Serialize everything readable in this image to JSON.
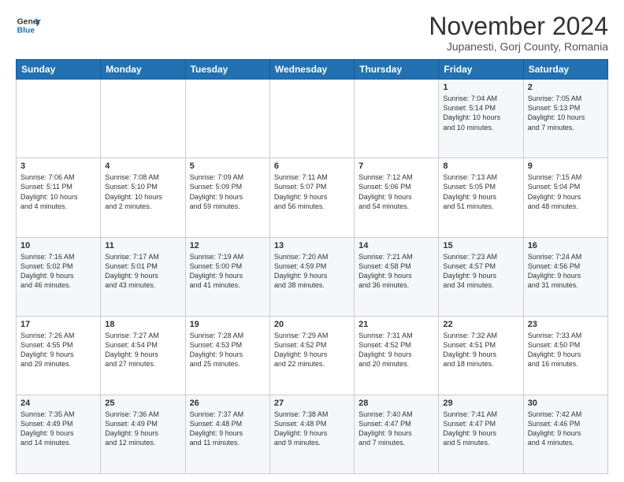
{
  "header": {
    "logo_line1": "General",
    "logo_line2": "Blue",
    "month": "November 2024",
    "location": "Jupanesti, Gorj County, Romania"
  },
  "days_of_week": [
    "Sunday",
    "Monday",
    "Tuesday",
    "Wednesday",
    "Thursday",
    "Friday",
    "Saturday"
  ],
  "weeks": [
    [
      {
        "day": "",
        "info": ""
      },
      {
        "day": "",
        "info": ""
      },
      {
        "day": "",
        "info": ""
      },
      {
        "day": "",
        "info": ""
      },
      {
        "day": "",
        "info": ""
      },
      {
        "day": "1",
        "info": "Sunrise: 7:04 AM\nSunset: 5:14 PM\nDaylight: 10 hours\nand 10 minutes."
      },
      {
        "day": "2",
        "info": "Sunrise: 7:05 AM\nSunset: 5:13 PM\nDaylight: 10 hours\nand 7 minutes."
      }
    ],
    [
      {
        "day": "3",
        "info": "Sunrise: 7:06 AM\nSunset: 5:11 PM\nDaylight: 10 hours\nand 4 minutes."
      },
      {
        "day": "4",
        "info": "Sunrise: 7:08 AM\nSunset: 5:10 PM\nDaylight: 10 hours\nand 2 minutes."
      },
      {
        "day": "5",
        "info": "Sunrise: 7:09 AM\nSunset: 5:09 PM\nDaylight: 9 hours\nand 59 minutes."
      },
      {
        "day": "6",
        "info": "Sunrise: 7:11 AM\nSunset: 5:07 PM\nDaylight: 9 hours\nand 56 minutes."
      },
      {
        "day": "7",
        "info": "Sunrise: 7:12 AM\nSunset: 5:06 PM\nDaylight: 9 hours\nand 54 minutes."
      },
      {
        "day": "8",
        "info": "Sunrise: 7:13 AM\nSunset: 5:05 PM\nDaylight: 9 hours\nand 51 minutes."
      },
      {
        "day": "9",
        "info": "Sunrise: 7:15 AM\nSunset: 5:04 PM\nDaylight: 9 hours\nand 48 minutes."
      }
    ],
    [
      {
        "day": "10",
        "info": "Sunrise: 7:16 AM\nSunset: 5:02 PM\nDaylight: 9 hours\nand 46 minutes."
      },
      {
        "day": "11",
        "info": "Sunrise: 7:17 AM\nSunset: 5:01 PM\nDaylight: 9 hours\nand 43 minutes."
      },
      {
        "day": "12",
        "info": "Sunrise: 7:19 AM\nSunset: 5:00 PM\nDaylight: 9 hours\nand 41 minutes."
      },
      {
        "day": "13",
        "info": "Sunrise: 7:20 AM\nSunset: 4:59 PM\nDaylight: 9 hours\nand 38 minutes."
      },
      {
        "day": "14",
        "info": "Sunrise: 7:21 AM\nSunset: 4:58 PM\nDaylight: 9 hours\nand 36 minutes."
      },
      {
        "day": "15",
        "info": "Sunrise: 7:23 AM\nSunset: 4:57 PM\nDaylight: 9 hours\nand 34 minutes."
      },
      {
        "day": "16",
        "info": "Sunrise: 7:24 AM\nSunset: 4:56 PM\nDaylight: 9 hours\nand 31 minutes."
      }
    ],
    [
      {
        "day": "17",
        "info": "Sunrise: 7:26 AM\nSunset: 4:55 PM\nDaylight: 9 hours\nand 29 minutes."
      },
      {
        "day": "18",
        "info": "Sunrise: 7:27 AM\nSunset: 4:54 PM\nDaylight: 9 hours\nand 27 minutes."
      },
      {
        "day": "19",
        "info": "Sunrise: 7:28 AM\nSunset: 4:53 PM\nDaylight: 9 hours\nand 25 minutes."
      },
      {
        "day": "20",
        "info": "Sunrise: 7:29 AM\nSunset: 4:52 PM\nDaylight: 9 hours\nand 22 minutes."
      },
      {
        "day": "21",
        "info": "Sunrise: 7:31 AM\nSunset: 4:52 PM\nDaylight: 9 hours\nand 20 minutes."
      },
      {
        "day": "22",
        "info": "Sunrise: 7:32 AM\nSunset: 4:51 PM\nDaylight: 9 hours\nand 18 minutes."
      },
      {
        "day": "23",
        "info": "Sunrise: 7:33 AM\nSunset: 4:50 PM\nDaylight: 9 hours\nand 16 minutes."
      }
    ],
    [
      {
        "day": "24",
        "info": "Sunrise: 7:35 AM\nSunset: 4:49 PM\nDaylight: 9 hours\nand 14 minutes."
      },
      {
        "day": "25",
        "info": "Sunrise: 7:36 AM\nSunset: 4:49 PM\nDaylight: 9 hours\nand 12 minutes."
      },
      {
        "day": "26",
        "info": "Sunrise: 7:37 AM\nSunset: 4:48 PM\nDaylight: 9 hours\nand 11 minutes."
      },
      {
        "day": "27",
        "info": "Sunrise: 7:38 AM\nSunset: 4:48 PM\nDaylight: 9 hours\nand 9 minutes."
      },
      {
        "day": "28",
        "info": "Sunrise: 7:40 AM\nSunset: 4:47 PM\nDaylight: 9 hours\nand 7 minutes."
      },
      {
        "day": "29",
        "info": "Sunrise: 7:41 AM\nSunset: 4:47 PM\nDaylight: 9 hours\nand 5 minutes."
      },
      {
        "day": "30",
        "info": "Sunrise: 7:42 AM\nSunset: 4:46 PM\nDaylight: 9 hours\nand 4 minutes."
      }
    ]
  ]
}
